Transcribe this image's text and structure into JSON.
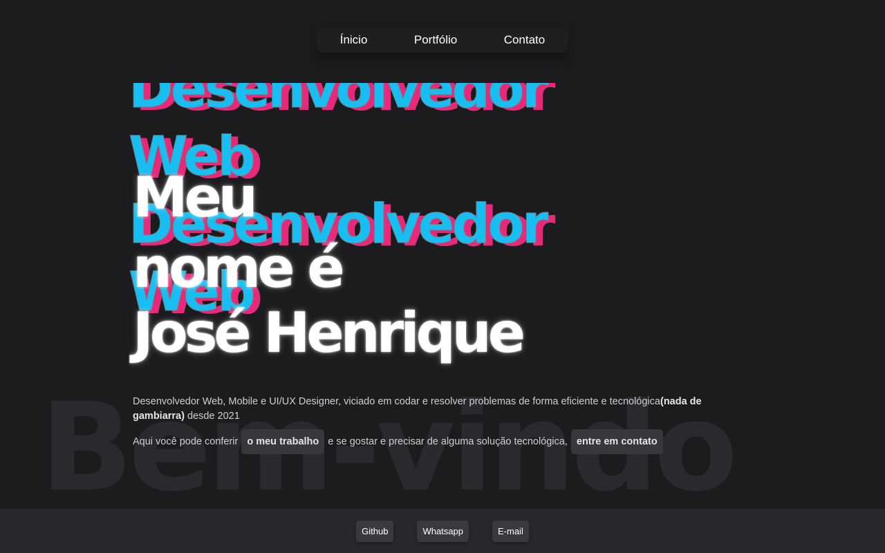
{
  "nav": {
    "items": [
      "Ínicio",
      "Portfólio",
      "Contato"
    ]
  },
  "hero": {
    "role_word1": "Desenvolvedor",
    "role_word2": "Web",
    "name_line1": "Meu",
    "name_line2": "nome é",
    "name_line3": "José Henrique"
  },
  "intro": {
    "text_before": "Desenvolvedor Web, Mobile e UI/UX Designer, viciado em codar e resolver problemas de forma eficiente e tecnológica",
    "bold": "(nada de gambiarra)",
    "text_after": " desde 2021"
  },
  "cta": {
    "text1": "Aqui você pode conferir",
    "link1": "o meu trabalho",
    "text2": "e se gostar e precisar de alguma solução tecnológica,",
    "link2": "entre em contato"
  },
  "watermark": "Bem-vindo",
  "footer": {
    "links": [
      "Github",
      "Whatsapp",
      "E-mail"
    ]
  },
  "colors": {
    "background": "#1c1b1e",
    "accent_cyan": "#18bdf2",
    "accent_pink": "#e7287b",
    "footer_bg": "#29282c"
  }
}
